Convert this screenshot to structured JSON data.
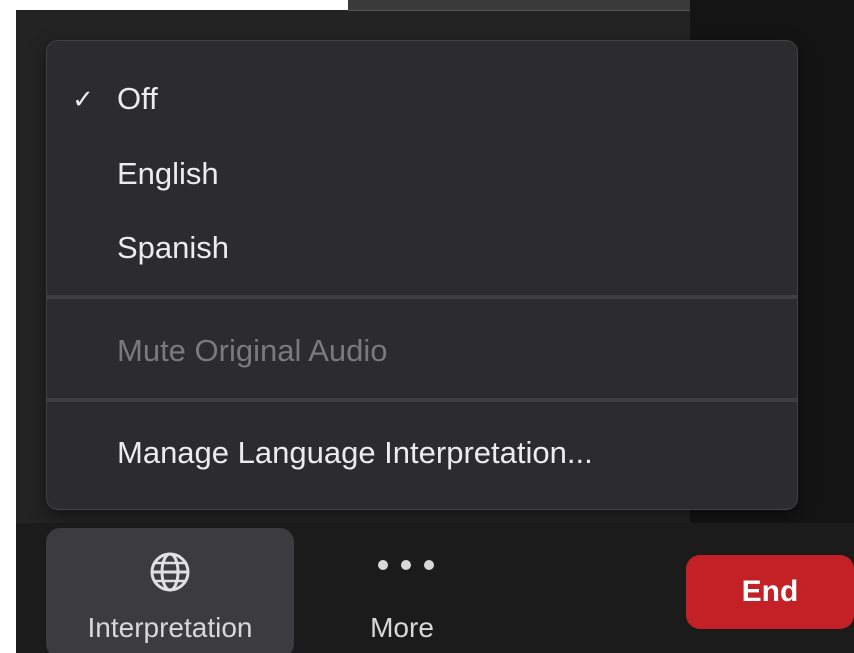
{
  "menu": {
    "items": [
      {
        "label": "Off",
        "checked": true,
        "enabled": true
      },
      {
        "label": "English",
        "checked": false,
        "enabled": true
      },
      {
        "label": "Spanish",
        "checked": false,
        "enabled": true
      }
    ],
    "check_glyph": "✓",
    "mute_original_audio": {
      "label": "Mute Original Audio",
      "enabled": false
    },
    "manage": {
      "label": "Manage Language Interpretation...",
      "enabled": true
    }
  },
  "toolbar": {
    "interpretation": {
      "label": "Interpretation",
      "icon": "globe-icon"
    },
    "more": {
      "label": "More",
      "icon": "more-dots-icon"
    },
    "end": {
      "label": "End"
    }
  },
  "colors": {
    "menu_background": "#2c2c2e",
    "menu_text": "#ececec",
    "disabled_text": "#7a7a7c",
    "toolbar_background": "#1b1b1b",
    "end_button": "#c42127"
  }
}
